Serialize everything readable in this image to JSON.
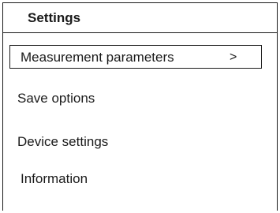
{
  "header": {
    "title": "Settings"
  },
  "menu": {
    "items": [
      {
        "label": "Measurement parameters",
        "selected": true,
        "arrow": ">"
      },
      {
        "label": "Save options",
        "selected": false
      },
      {
        "label": "Device settings",
        "selected": false
      },
      {
        "label": "Information",
        "selected": false
      }
    ]
  }
}
